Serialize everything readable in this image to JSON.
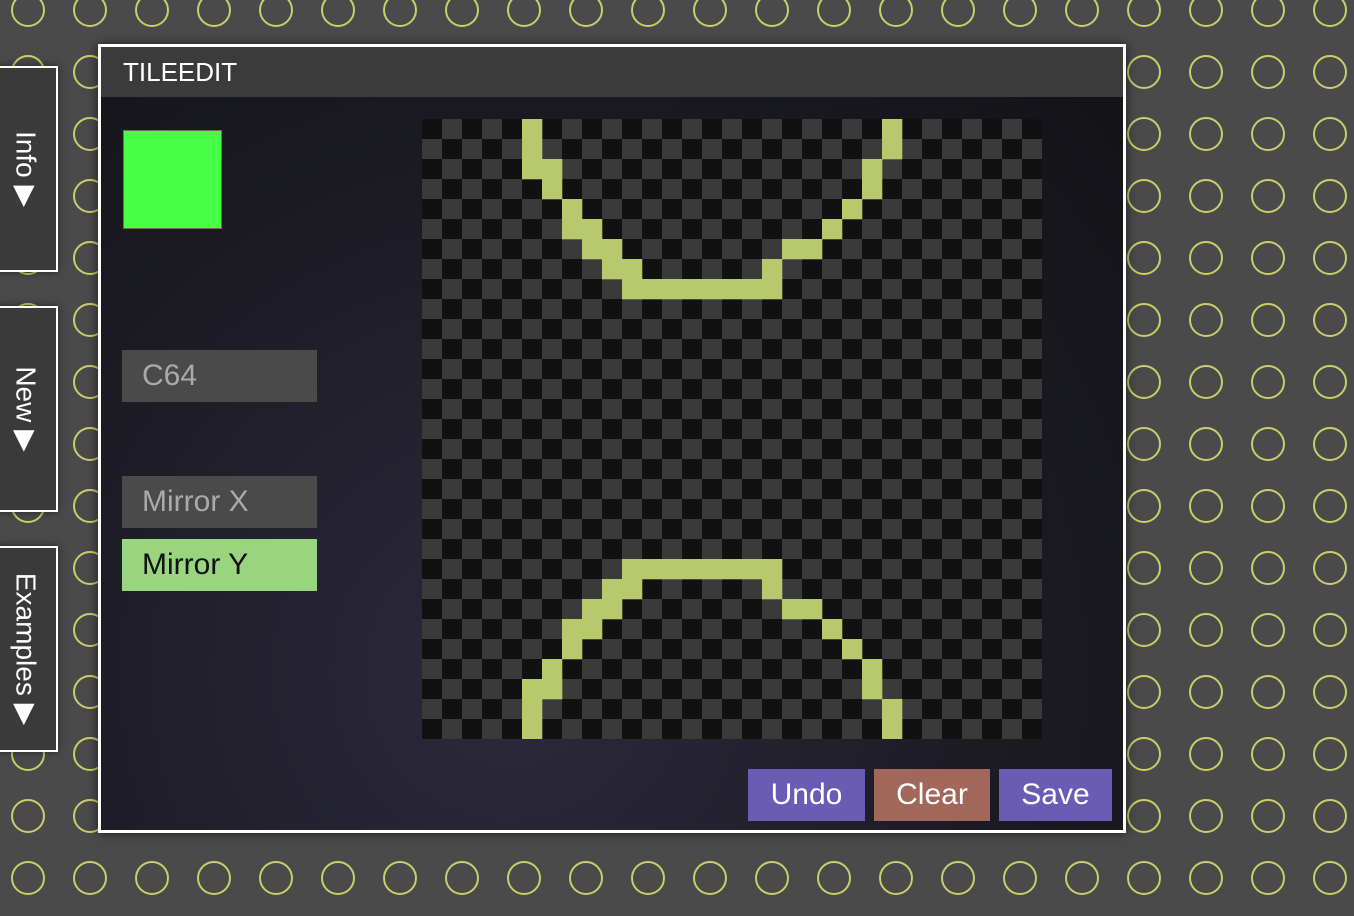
{
  "side_tabs": [
    {
      "label": "Info ▶"
    },
    {
      "label": "New ▶"
    },
    {
      "label": "Examples ▶"
    }
  ],
  "window": {
    "title": "TILEEDIT",
    "current_color": "#47ff47",
    "palette_button": "C64",
    "mirror_x_label": "Mirror X",
    "mirror_y_label": "Mirror Y",
    "mirror_x_active": false,
    "mirror_y_active": true,
    "undo_label": "Undo",
    "clear_label": "Clear",
    "save_label": "Save"
  },
  "colors": {
    "background_pattern": "#4a4a4a",
    "ring_color": "#c8cf6a",
    "pixel_color": "#b8c86c",
    "checker_dark": "#111111",
    "checker_light": "#3a3a3a",
    "active_button": "#99d57f",
    "inactive_button": "#4a4a4a",
    "undo_save_color": "#6a5bb5",
    "clear_color": "#a0675a"
  },
  "tile": {
    "size": 31,
    "pixels": [
      [
        5,
        0
      ],
      [
        5,
        1
      ],
      [
        5,
        2
      ],
      [
        6,
        2
      ],
      [
        6,
        3
      ],
      [
        7,
        4
      ],
      [
        7,
        5
      ],
      [
        8,
        5
      ],
      [
        8,
        6
      ],
      [
        9,
        6
      ],
      [
        9,
        7
      ],
      [
        10,
        7
      ],
      [
        10,
        8
      ],
      [
        11,
        8
      ],
      [
        12,
        8
      ],
      [
        13,
        8
      ],
      [
        14,
        8
      ],
      [
        15,
        8
      ],
      [
        16,
        8
      ],
      [
        17,
        8
      ],
      [
        17,
        7
      ],
      [
        18,
        6
      ],
      [
        19,
        6
      ],
      [
        20,
        5
      ],
      [
        21,
        4
      ],
      [
        22,
        3
      ],
      [
        22,
        2
      ],
      [
        23,
        1
      ],
      [
        23,
        0
      ],
      [
        5,
        30
      ],
      [
        5,
        29
      ],
      [
        5,
        28
      ],
      [
        6,
        28
      ],
      [
        6,
        27
      ],
      [
        7,
        26
      ],
      [
        7,
        25
      ],
      [
        8,
        25
      ],
      [
        8,
        24
      ],
      [
        9,
        24
      ],
      [
        9,
        23
      ],
      [
        10,
        23
      ],
      [
        10,
        22
      ],
      [
        11,
        22
      ],
      [
        12,
        22
      ],
      [
        13,
        22
      ],
      [
        14,
        22
      ],
      [
        15,
        22
      ],
      [
        16,
        22
      ],
      [
        17,
        22
      ],
      [
        17,
        23
      ],
      [
        18,
        24
      ],
      [
        19,
        24
      ],
      [
        20,
        25
      ],
      [
        21,
        26
      ],
      [
        22,
        27
      ],
      [
        22,
        28
      ],
      [
        23,
        29
      ],
      [
        23,
        30
      ]
    ]
  }
}
